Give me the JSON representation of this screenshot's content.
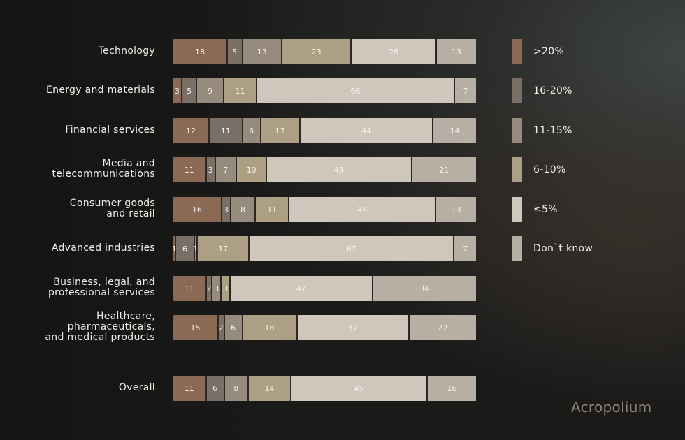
{
  "chart_data": {
    "type": "bar",
    "orientation": "horizontal",
    "stacked": true,
    "normalized": true,
    "title": "",
    "xlabel": "",
    "ylabel": "",
    "xlim": [
      0,
      100
    ],
    "grid": false,
    "legend_position": "right",
    "categories": [
      "Technology",
      "Energy and materials",
      "Financial services",
      "Media and\ntelecommunications",
      "Consumer goods\nand retail",
      "Advanced industries",
      "Business, legal, and\nprofessional services",
      "Healthcare,\npharmaceuticals,\nand medical products",
      "Overall"
    ],
    "series": [
      {
        "name": ">20%",
        "color": "#8a6a55",
        "values": [
          18,
          3,
          12,
          11,
          16,
          1,
          11,
          15,
          11
        ]
      },
      {
        "name": "16-20%",
        "color": "#7a6f66",
        "values": [
          5,
          5,
          11,
          3,
          3,
          6,
          2,
          2,
          6
        ]
      },
      {
        "name": "11-15%",
        "color": "#968b7c",
        "values": [
          13,
          9,
          6,
          7,
          8,
          1,
          3,
          6,
          8
        ]
      },
      {
        "name": "6-10%",
        "color": "#ad9f84",
        "values": [
          23,
          11,
          13,
          10,
          11,
          17,
          3,
          18,
          14
        ]
      },
      {
        "name": "≤5%",
        "color": "#cfc7bb",
        "values": [
          28,
          66,
          44,
          48,
          48,
          67,
          47,
          37,
          45
        ]
      },
      {
        "name": "Don`t know",
        "color": "#b7afa3",
        "values": [
          13,
          7,
          14,
          21,
          13,
          7,
          34,
          22,
          16
        ]
      }
    ]
  },
  "brand": {
    "name": "Acropolium"
  }
}
